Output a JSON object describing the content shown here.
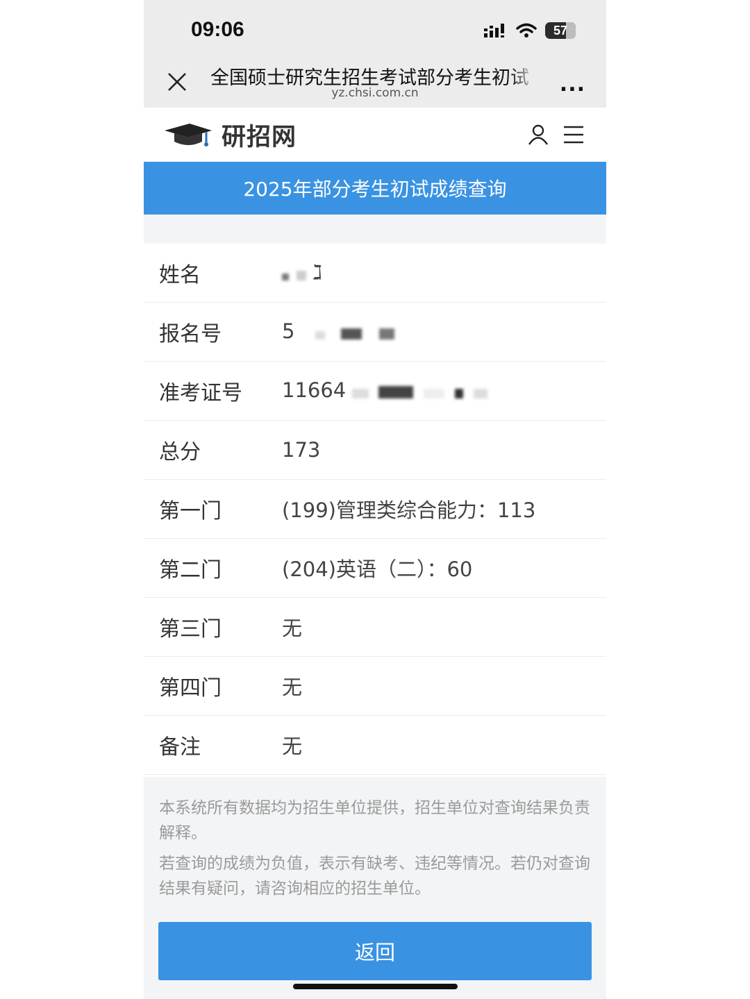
{
  "status_bar": {
    "time": "09:06",
    "battery": "57"
  },
  "browser": {
    "title": "全国硕士研究生招生考试部分考生初试",
    "url": "yz.chsi.com.cn",
    "more": "..."
  },
  "site": {
    "logo_text": "研招网"
  },
  "banner": {
    "title": "2025年部分考生初试成绩查询"
  },
  "results": {
    "name": {
      "label": "姓名",
      "value_visible": "ℷ"
    },
    "reg_no": {
      "label": "报名号",
      "value_visible": "5"
    },
    "exam_no": {
      "label": "准考证号",
      "value_visible": "11664"
    },
    "total": {
      "label": "总分",
      "value": "173"
    },
    "subject1": {
      "label": "第一门",
      "value": "(199)管理类综合能力：113"
    },
    "subject2": {
      "label": "第二门",
      "value": "(204)英语（二）：60"
    },
    "subject3": {
      "label": "第三门",
      "value": "无"
    },
    "subject4": {
      "label": "第四门",
      "value": "无"
    },
    "remark": {
      "label": "备注",
      "value": "无"
    }
  },
  "notice": {
    "line1": "本系统所有数据均为招生单位提供，招生单位对查询结果负责解释。",
    "line2": "若查询的成绩为负值，表示有缺考、违纪等情况。若仍对查询结果有疑问，请咨询相应的招生单位。"
  },
  "buttons": {
    "return_label": "返回"
  },
  "colors": {
    "accent": "#3a92e2",
    "band": "#f3f4f6"
  }
}
